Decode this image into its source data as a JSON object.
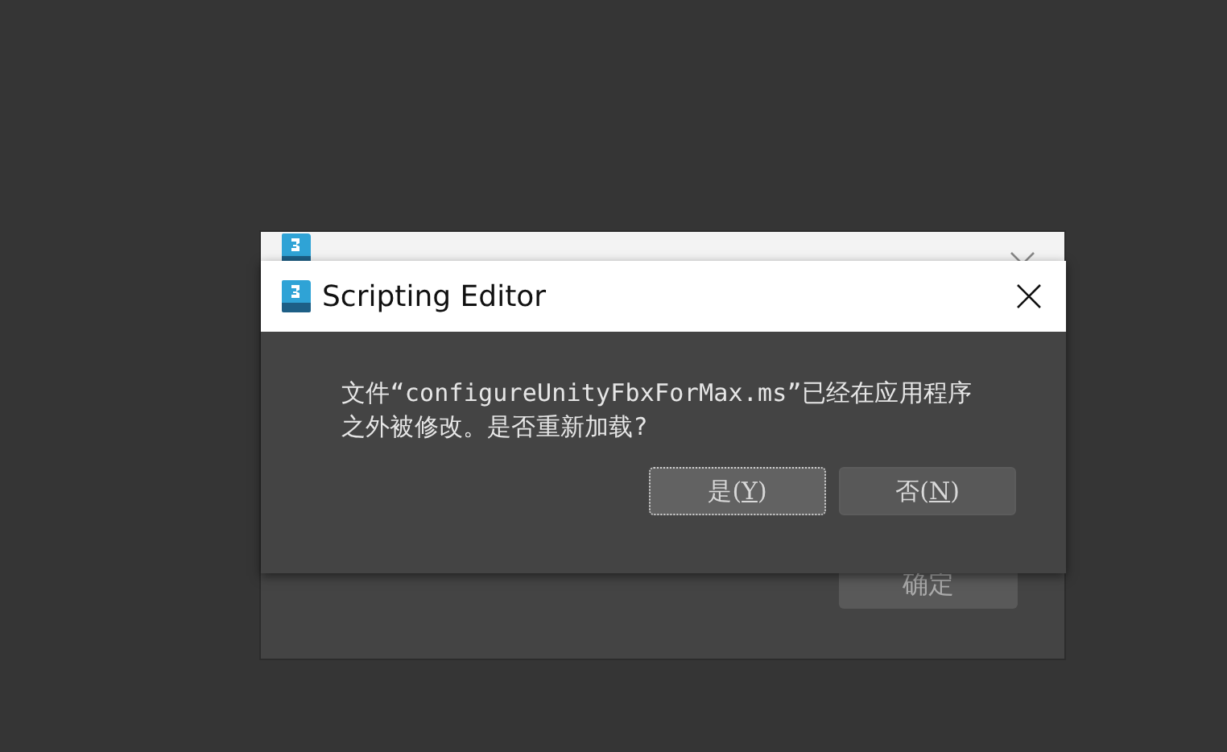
{
  "back_window": {
    "button": "确定"
  },
  "dialog": {
    "title": "Scripting Editor",
    "message": "文件“configureUnityFbxForMax.ms”已经在应用程序之外被修改。是否重新加载?",
    "buttons": [
      {
        "before": "是(",
        "key": "Y",
        "after": ")",
        "focused": true
      },
      {
        "before": "否(",
        "key": "N",
        "after": ")",
        "focused": false
      }
    ]
  }
}
